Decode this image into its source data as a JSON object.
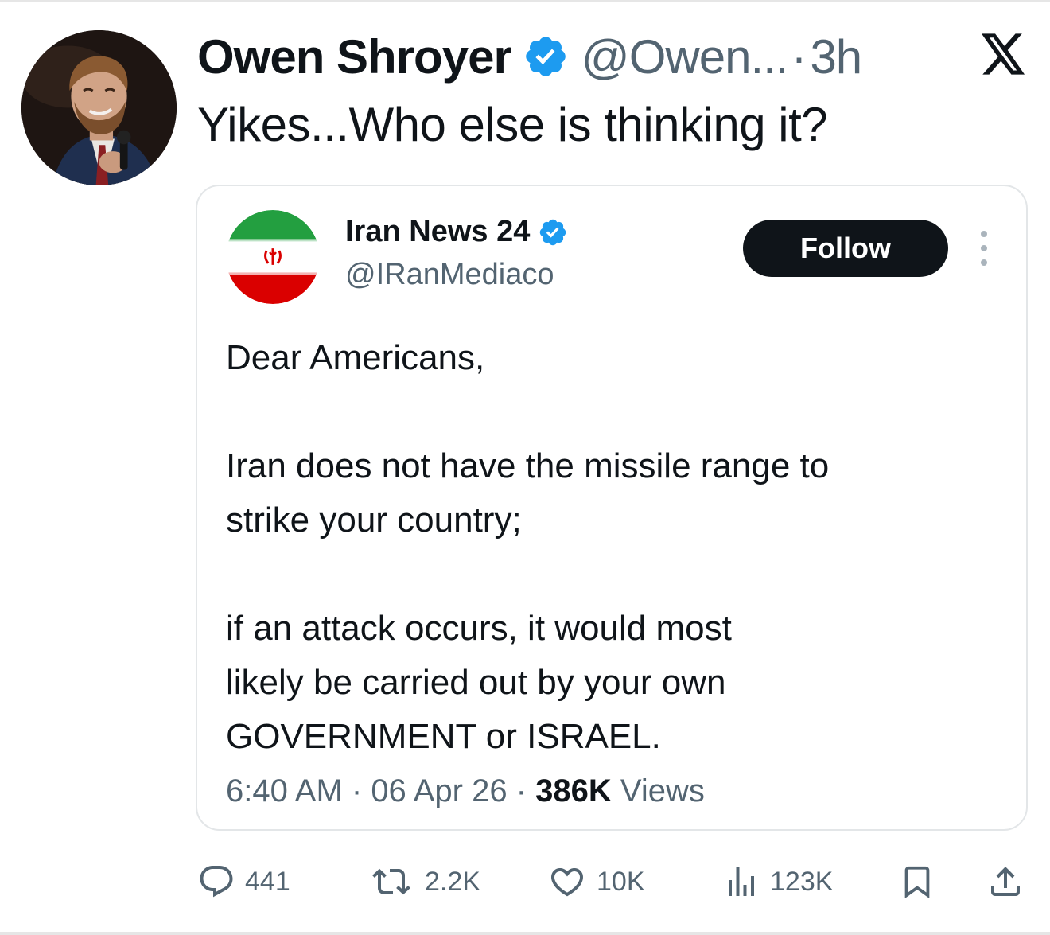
{
  "post": {
    "author_name": "Owen Shroyer",
    "author_handle": "@Owen...",
    "separator": "·",
    "time": "3h",
    "text": "Yikes...Who else is thinking it?"
  },
  "quoted": {
    "author_name": "Iran News 24",
    "author_handle": "@IRanMediaco",
    "follow_label": "Follow",
    "body": [
      "Dear Americans,",
      "Iran does not have the missile range to",
      "strike your country;",
      "if an attack occurs, it would most",
      "likely be carried out by your own",
      "GOVERNMENT or ISRAEL."
    ],
    "time": "6:40 AM",
    "date": "06 Apr 26",
    "views_count": "386K",
    "views_label": "Views"
  },
  "actions": {
    "replies": "441",
    "reposts": "2.2K",
    "likes": "10K",
    "views": "123K"
  },
  "icons": [
    "verified-icon",
    "x-logo-icon",
    "more-icon",
    "reply-icon",
    "repost-icon",
    "like-icon",
    "views-icon",
    "bookmark-icon",
    "share-icon"
  ],
  "colors": {
    "text": "#0f1419",
    "secondary_text": "#536471",
    "verified": "#1d9bf0",
    "follow_button": "#0f1419",
    "card_border": "#e3e6e8"
  }
}
